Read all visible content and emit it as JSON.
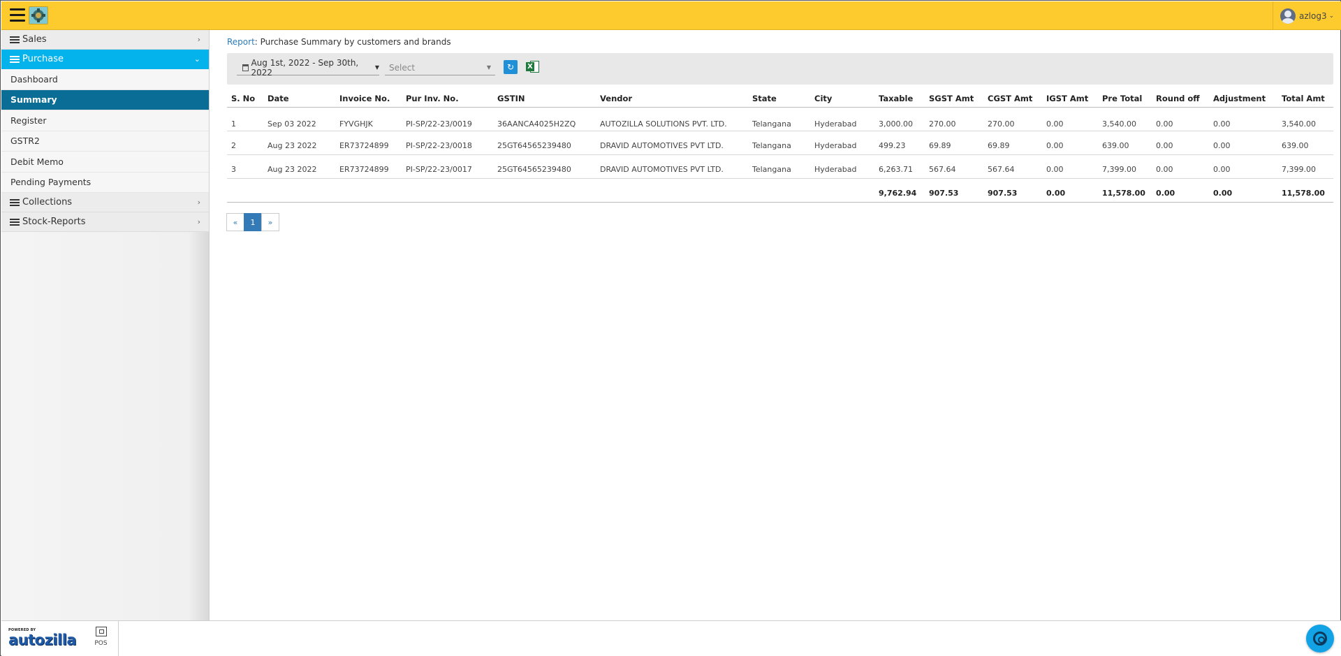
{
  "header": {
    "username": "azlog3"
  },
  "sidebar": {
    "sections": [
      {
        "label": "Sales"
      },
      {
        "label": "Purchase"
      },
      {
        "label": "Collections"
      },
      {
        "label": "Stock-Reports"
      }
    ],
    "purchase_items": [
      {
        "label": "Dashboard"
      },
      {
        "label": "Summary"
      },
      {
        "label": "Register"
      },
      {
        "label": "GSTR2"
      },
      {
        "label": "Debit Memo"
      },
      {
        "label": "Pending Payments"
      }
    ]
  },
  "breadcrumb": {
    "link": "Report",
    "title": ": Purchase Summary by customers and brands"
  },
  "filters": {
    "date_range": "Aug 1st, 2022 - Sep 30th, 2022",
    "select_placeholder": "Select"
  },
  "table": {
    "columns": [
      "S. No",
      "Date",
      "Invoice No.",
      "Pur Inv. No.",
      "GSTIN",
      "Vendor",
      "State",
      "City",
      "Taxable",
      "SGST Amt",
      "CGST Amt",
      "IGST Amt",
      "Pre Total",
      "Round off",
      "Adjustment",
      "Total Amt"
    ],
    "rows": [
      [
        "1",
        "Sep 03 2022",
        "FYVGHJK",
        "PI-SP/22-23/0019",
        "36AANCA4025H2ZQ",
        "AUTOZILLA SOLUTIONS PVT. LTD.",
        "Telangana",
        "Hyderabad",
        "3,000.00",
        "270.00",
        "270.00",
        "0.00",
        "3,540.00",
        "0.00",
        "0.00",
        "3,540.00"
      ],
      [
        "2",
        "Aug 23 2022",
        "ER73724899",
        "PI-SP/22-23/0018",
        "25GT64565239480",
        "DRAVID AUTOMOTIVES PVT LTD.",
        "Telangana",
        "Hyderabad",
        "499.23",
        "69.89",
        "69.89",
        "0.00",
        "639.00",
        "0.00",
        "0.00",
        "639.00"
      ],
      [
        "3",
        "Aug 23 2022",
        "ER73724899",
        "PI-SP/22-23/0017",
        "25GT64565239480",
        "DRAVID AUTOMOTIVES PVT LTD.",
        "Telangana",
        "Hyderabad",
        "6,263.71",
        "567.64",
        "567.64",
        "0.00",
        "7,399.00",
        "0.00",
        "0.00",
        "7,399.00"
      ]
    ],
    "totals": [
      "",
      "",
      "",
      "",
      "",
      "",
      "",
      "",
      "9,762.94",
      "907.53",
      "907.53",
      "0.00",
      "11,578.00",
      "0.00",
      "0.00",
      "11,578.00"
    ]
  },
  "pagination": {
    "prev": "«",
    "current": "1",
    "next": "»"
  },
  "footer": {
    "powered_by": "POWERED BY",
    "brand": "autozilla",
    "pos_label": "POS"
  },
  "colors": {
    "topbar": "#fecb2f",
    "active_section": "#04b3ec",
    "active_item": "#0a6d95"
  }
}
